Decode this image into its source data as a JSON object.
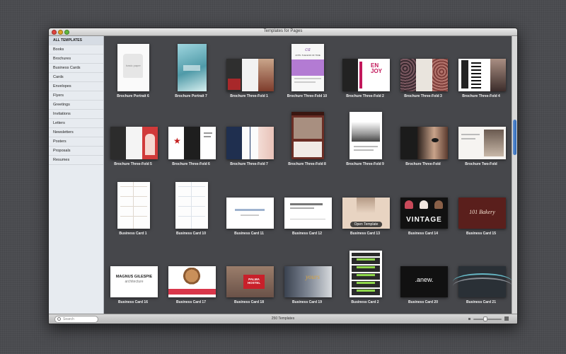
{
  "window": {
    "title": "Templates for Pages"
  },
  "sidebar": {
    "items": [
      "ALL TEMPLATES",
      "Books",
      "Brochures",
      "Business Cards",
      "Cards",
      "Envelopes",
      "Flyers",
      "Greetings",
      "Invitations",
      "Letters",
      "Newsletters",
      "Posters",
      "Proposals",
      "Resumes"
    ],
    "selected": "ALL TEMPLATES"
  },
  "templates": [
    {
      "label": "Brochure Portrait 6"
    },
    {
      "label": "Brochure Portrait 7"
    },
    {
      "label": "Brochure Three-Fold 1"
    },
    {
      "label": "Brochure Three-Fold 10"
    },
    {
      "label": "Brochure Three-Fold 2"
    },
    {
      "label": "Brochure Three-Fold 3"
    },
    {
      "label": "Brochure Three-Fold 4"
    },
    {
      "label": "Brochure Three-Fold 5"
    },
    {
      "label": "Brochure Three-Fold 6"
    },
    {
      "label": "Brochure Three-Fold 7"
    },
    {
      "label": "Brochure Three-Fold 8"
    },
    {
      "label": "Brochure Three-Fold 9"
    },
    {
      "label": "Brochure Three-Fold"
    },
    {
      "label": "Brochure Two-Fold"
    },
    {
      "label": "Business Card 1"
    },
    {
      "label": "Business Card 10"
    },
    {
      "label": "Business Card 11"
    },
    {
      "label": "Business Card 12"
    },
    {
      "label": "Business Card 13",
      "action": "Open Template"
    },
    {
      "label": "Business Card 14"
    },
    {
      "label": "Business Card 15"
    },
    {
      "label": "Business Card 16"
    },
    {
      "label": "Business Card 17"
    },
    {
      "label": "Business Card 18"
    },
    {
      "label": "Business Card 19"
    },
    {
      "label": "Business Card 2"
    },
    {
      "label": "Business Card 20"
    },
    {
      "label": "Business Card 21"
    }
  ],
  "footer": {
    "search_placeholder": "Search",
    "count": "250 Templates"
  },
  "thumb_text": {
    "basic_paper": "basic paper",
    "logo": "ca",
    "until_end": "UNTIL THE END OF TIME",
    "enjoy": "EN JOY",
    "vintage": "VINTAGE",
    "bakery": "101 Bakery",
    "magnus": "MAGNUS GILESPIE",
    "architecture": "architecture",
    "palma": "PALMA HOSTEL",
    "anew": ".anew.",
    "yours": "yours"
  }
}
